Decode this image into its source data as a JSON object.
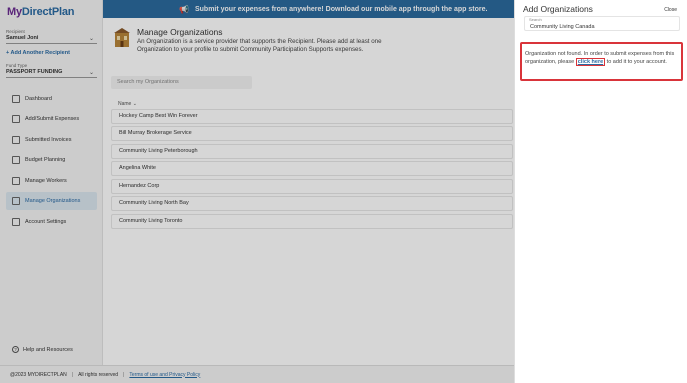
{
  "brand": {
    "my": "My",
    "rest": "DirectPlan"
  },
  "sidebar": {
    "recipient_label": "Recipient",
    "recipient_value": "Samuel Joni",
    "add_recipient": "+ Add Another Recipient",
    "fund_label": "Fund Type",
    "fund_value": "PASSPORT FUNDING",
    "items": [
      {
        "label": "Dashboard",
        "icon": "dashboard-icon"
      },
      {
        "label": "Add/Submit Expenses",
        "icon": "receipt-icon"
      },
      {
        "label": "Submitted Invoices",
        "icon": "invoice-icon"
      },
      {
        "label": "Budget Planning",
        "icon": "grid-icon"
      },
      {
        "label": "Manage Workers",
        "icon": "workers-icon"
      },
      {
        "label": "Manage Organizations",
        "icon": "organization-icon"
      },
      {
        "label": "Account Settings",
        "icon": "user-icon"
      }
    ],
    "help": "Help and Resources"
  },
  "banner": {
    "text": "Submit your expenses from anywhere! Download our mobile app through the app store."
  },
  "main": {
    "title": "Manage Organizations",
    "description": "An Organization is a service provider that supports the Recipient. Please add at least one Organization to your profile to submit Community Participation Supports expenses.",
    "search_placeholder": "Search my Organizations",
    "column_header": "Name ⌄",
    "organizations": [
      "Hockey Camp Best Win Forever",
      "Bill Murray Brokerage Service",
      "Community Living Peterborough",
      "Angelina White",
      "Hernandez Corp",
      "Community Living North Bay",
      "Community Living Toronto"
    ]
  },
  "footer": {
    "copyright": "@2023 MYDIRECTPLAN",
    "rights": "All rights reserved",
    "terms": "Terms of use and Privacy Policy"
  },
  "panel": {
    "title": "Add Organizations",
    "close": "Close",
    "search_label": "Search",
    "search_value": "Community Living Canada",
    "msg_before": "Organization not found. In order to submit expenses from this organization, please ",
    "click_here": "click here",
    "msg_after": " to add it to your account."
  },
  "colors": {
    "brand_blue": "#2b6a9e",
    "brand_purple": "#6a2c91",
    "highlight_red": "#d9343a"
  }
}
